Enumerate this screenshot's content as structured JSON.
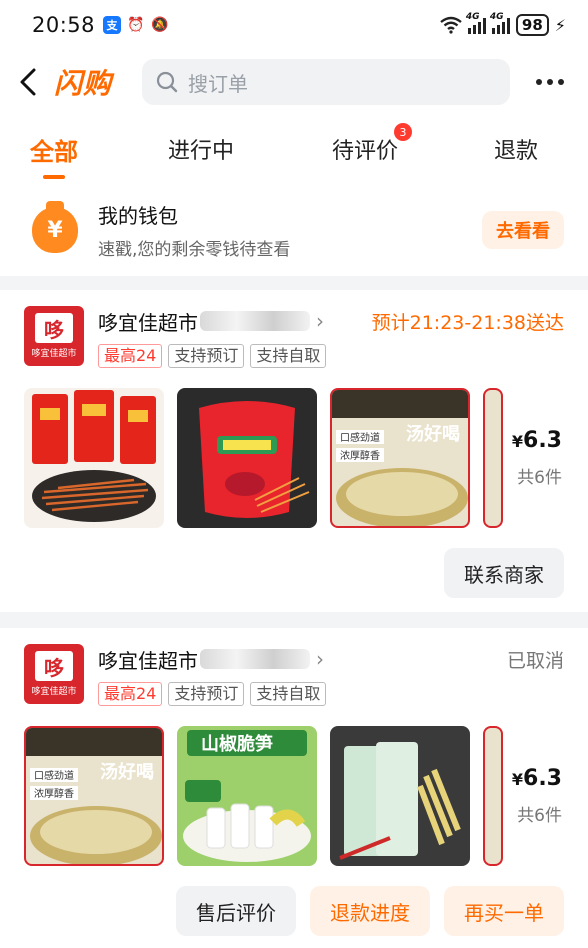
{
  "status_bar": {
    "time": "20:58",
    "signal_1_label": "4G",
    "signal_2_label": "4G",
    "battery": "98"
  },
  "header": {
    "brand": "闪购",
    "search_placeholder": "搜订单"
  },
  "tabs": [
    {
      "label": "全部",
      "active": true
    },
    {
      "label": "进行中"
    },
    {
      "label": "待评价",
      "badge": "3"
    },
    {
      "label": "退款"
    }
  ],
  "wallet": {
    "title": "我的钱包",
    "subtitle": "速戳,您的剩余零钱待查看",
    "button": "去看看"
  },
  "orders": [
    {
      "shop_name": "哆宜佳超市",
      "shop_logo_text": "哆宜佳超市",
      "status": "预计21:23-21:38送达",
      "tags": [
        "最高24",
        "支持预订",
        "支持自取"
      ],
      "price_currency": "¥",
      "price": "6.3",
      "count": "共6件",
      "buttons": [
        "联系商家"
      ]
    },
    {
      "shop_name": "哆宜佳超市",
      "shop_logo_text": "哆宜佳超市",
      "status": "已取消",
      "tags": [
        "最高24",
        "支持预订",
        "支持自取"
      ],
      "price_currency": "¥",
      "price": "6.3",
      "count": "共6件",
      "buttons": [
        "售后评价",
        "退款进度",
        "再买一单"
      ]
    }
  ],
  "colors": {
    "accent": "#ff6a00",
    "badge": "#ff3b30",
    "shop_red": "#d7262c"
  }
}
